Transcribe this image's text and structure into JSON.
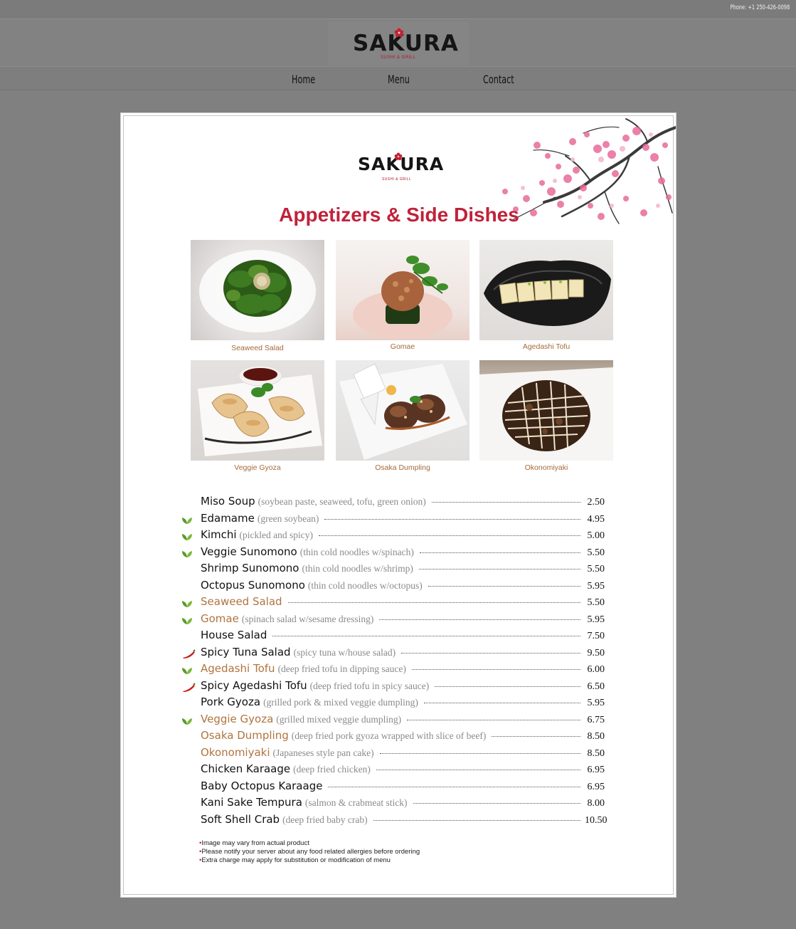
{
  "topbar": {
    "phone": "Phone: +1 250-426-0098"
  },
  "header": {
    "logo_text": "SAKURA",
    "logo_sub": "SUSHI & GRILL"
  },
  "nav": {
    "items": [
      "Home",
      "Menu",
      "Contact"
    ]
  },
  "menu": {
    "logo_text": "SAKURA",
    "logo_sub": "SUSHI & GRILL",
    "title": "Appetizers & Side Dishes",
    "photos": [
      {
        "caption": "Seaweed Salad"
      },
      {
        "caption": "Gomae"
      },
      {
        "caption": "Agedashi Tofu"
      },
      {
        "caption": "Veggie Gyoza"
      },
      {
        "caption": "Osaka Dumpling"
      },
      {
        "caption": "Okonomiyaki"
      }
    ],
    "items": [
      {
        "name": "Miso Soup",
        "desc": "(soybean paste, seaweed, tofu, green onion)",
        "price": "2.50",
        "icon": "",
        "highlight": false
      },
      {
        "name": "Edamame",
        "desc": "(green soybean)",
        "price": "4.95",
        "icon": "leaf-icon",
        "highlight": false
      },
      {
        "name": "Kimchi",
        "desc": "(pickled and spicy)",
        "price": "5.00",
        "icon": "leaf-icon",
        "highlight": false
      },
      {
        "name": "Veggie Sunomono",
        "desc": "(thin cold noodles w/spinach)",
        "price": "5.50",
        "icon": "leaf-icon",
        "highlight": false
      },
      {
        "name": "Shrimp Sunomono",
        "desc": "(thin cold noodles w/shrimp)",
        "price": "5.50",
        "icon": "",
        "highlight": false
      },
      {
        "name": "Octopus Sunomono",
        "desc": "(thin cold noodles w/octopus)",
        "price": "5.95",
        "icon": "",
        "highlight": false
      },
      {
        "name": "Seaweed Salad",
        "desc": "",
        "price": "5.50",
        "icon": "leaf-icon",
        "highlight": true
      },
      {
        "name": "Gomae",
        "desc": "(spinach salad w/sesame dressing)",
        "price": "5.95",
        "icon": "leaf-icon",
        "highlight": true
      },
      {
        "name": "House Salad",
        "desc": "",
        "price": "7.50",
        "icon": "",
        "highlight": false
      },
      {
        "name": "Spicy Tuna Salad",
        "desc": "(spicy tuna w/house salad)",
        "price": "9.50",
        "icon": "chili-icon",
        "highlight": false
      },
      {
        "name": "Agedashi Tofu",
        "desc": "(deep fried tofu in dipping sauce)",
        "price": "6.00",
        "icon": "leaf-icon",
        "highlight": true
      },
      {
        "name": "Spicy Agedashi Tofu",
        "desc": "(deep fried tofu in spicy sauce)",
        "price": "6.50",
        "icon": "chili-icon",
        "highlight": false
      },
      {
        "name": "Pork Gyoza",
        "desc": "(grilled pork & mixed veggie dumpling)",
        "price": "5.95",
        "icon": "",
        "highlight": false
      },
      {
        "name": "Veggie Gyoza",
        "desc": "(grilled mixed veggie dumpling)",
        "price": "6.75",
        "icon": "leaf-icon",
        "highlight": true
      },
      {
        "name": "Osaka Dumpling",
        "desc": "(deep fried pork gyoza wrapped with slice of beef)",
        "price": "8.50",
        "icon": "",
        "highlight": true
      },
      {
        "name": "Okonomiyaki",
        "desc": "(Japaneses style pan cake)",
        "price": "8.50",
        "icon": "",
        "highlight": true
      },
      {
        "name": "Chicken Karaage",
        "desc": "(deep fried chicken)",
        "price": "6.95",
        "icon": "",
        "highlight": false
      },
      {
        "name": "Baby Octopus Karaage",
        "desc": "",
        "price": "6.95",
        "icon": "",
        "highlight": false
      },
      {
        "name": "Kani Sake Tempura",
        "desc": "(salmon & crabmeat stick)",
        "price": "8.00",
        "icon": "",
        "highlight": false
      },
      {
        "name": "Soft Shell Crab",
        "desc": "(deep fried baby crab)",
        "price": "10.50",
        "icon": "",
        "highlight": false
      }
    ],
    "notes": [
      "Image may vary from actual product",
      "Please notify your server about any food related allergies before ordering",
      "Extra charge may apply for substitution or modification of menu"
    ],
    "colors": {
      "title": "#c0223a",
      "highlight_item": "#b0743f",
      "leaf": "#6a9a2c",
      "chili": "#c8201c"
    }
  }
}
